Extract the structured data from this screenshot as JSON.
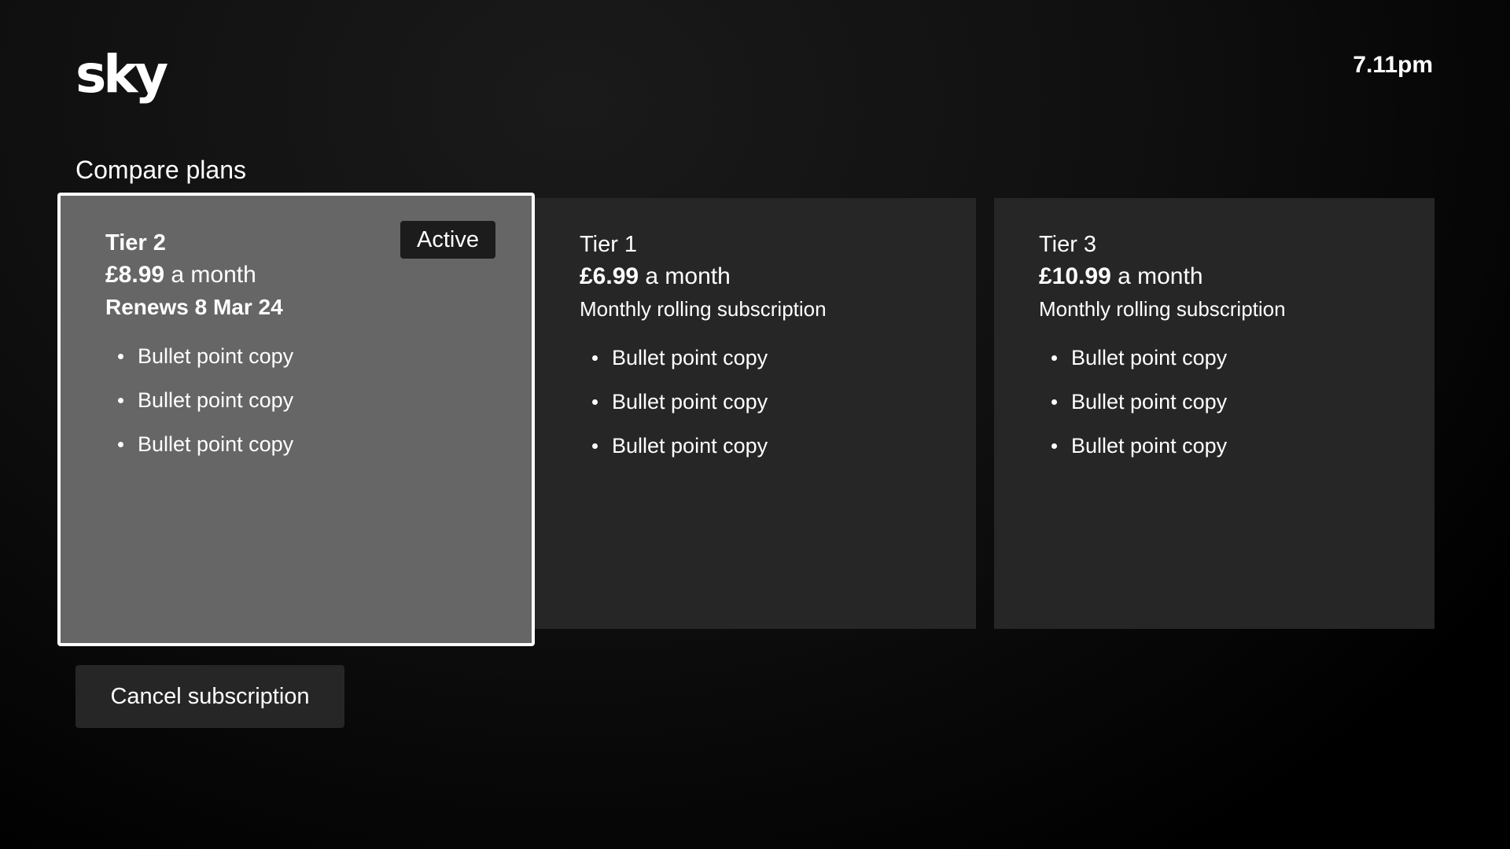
{
  "header": {
    "logo_text": "sky",
    "clock": "7.11pm"
  },
  "section_title": "Compare plans",
  "plans": [
    {
      "tier": "Tier 2",
      "price": "£8.99",
      "period": " a month",
      "subtitle": "Renews 8 Mar 24",
      "badge": "Active",
      "bullets": [
        "Bullet point copy",
        "Bullet point copy",
        "Bullet point copy"
      ]
    },
    {
      "tier": "Tier 1",
      "price": "£6.99",
      "period": " a month",
      "subtitle": "Monthly rolling subscription",
      "bullets": [
        "Bullet point copy",
        "Bullet point copy",
        "Bullet point copy"
      ]
    },
    {
      "tier": "Tier 3",
      "price": "£10.99",
      "period": " a month",
      "subtitle": "Monthly rolling subscription",
      "bullets": [
        "Bullet point copy",
        "Bullet point copy",
        "Bullet point copy"
      ]
    }
  ],
  "actions": {
    "cancel_label": "Cancel subscription"
  },
  "colors": {
    "background": "#000000",
    "card": "#262626",
    "card_active": "#666666",
    "focus_border": "#ffffff",
    "badge": "#1c1c1c"
  }
}
